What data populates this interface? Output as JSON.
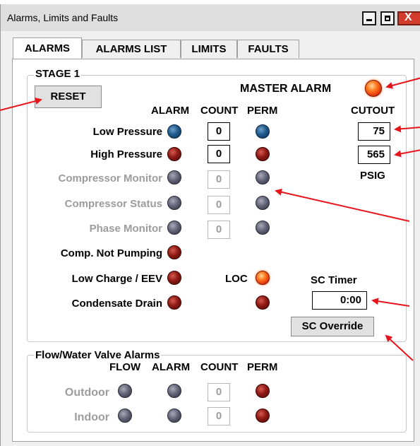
{
  "window": {
    "title": "Alarms, Limits and Faults",
    "controls": {
      "minimize_icon": "minimize-icon",
      "maximize_icon": "maximize-icon",
      "close_glyph": "X"
    }
  },
  "tabs": [
    {
      "label": "ALARMS",
      "active": true
    },
    {
      "label": "ALARMS LIST",
      "active": false
    },
    {
      "label": "LIMITS",
      "active": false
    },
    {
      "label": "FAULTS",
      "active": false
    }
  ],
  "stage": {
    "title": "STAGE 1",
    "reset_label": "RESET",
    "master_alarm": {
      "label": "MASTER ALARM",
      "indicator": "on",
      "color": "#ff5a1a"
    },
    "columns": {
      "alarm": "ALARM",
      "count": "COUNT",
      "perm": "PERM"
    },
    "cutout": {
      "header": "CUTOUT",
      "low_value": "75",
      "high_value": "565",
      "unit": "PSIG"
    },
    "rows": [
      {
        "label": "Low Pressure",
        "enabled": true,
        "alarm_color": "blue",
        "count": "0",
        "perm_color": "blue"
      },
      {
        "label": "High Pressure",
        "enabled": true,
        "alarm_color": "red",
        "count": "0",
        "perm_color": "red"
      },
      {
        "label": "Compressor Monitor",
        "enabled": false,
        "alarm_color": "gray",
        "count": "0",
        "perm_color": "gray"
      },
      {
        "label": "Compressor Status",
        "enabled": false,
        "alarm_color": "gray",
        "count": "0",
        "perm_color": "gray"
      },
      {
        "label": "Phase Monitor",
        "enabled": false,
        "alarm_color": "gray",
        "count": "0",
        "perm_color": "gray"
      },
      {
        "label": "Comp. Not Pumping",
        "enabled": true,
        "alarm_color": "red"
      },
      {
        "label": "Low Charge / EEV",
        "enabled": true,
        "alarm_color": "red"
      },
      {
        "label": "Condensate Drain",
        "enabled": true,
        "alarm_color": "red",
        "perm_color": "red"
      }
    ],
    "loc": {
      "label": "LOC",
      "indicator": "on"
    },
    "sc_timer": {
      "label": "SC Timer",
      "value": "0:00"
    },
    "sc_override_label": "SC Override"
  },
  "flow": {
    "title": "Flow/Water Valve Alarms",
    "columns": {
      "flow": "FLOW",
      "alarm": "ALARM",
      "count": "COUNT",
      "perm": "PERM"
    },
    "rows": [
      {
        "label": "Outdoor",
        "flow_color": "gray",
        "alarm_color": "gray",
        "count": "0",
        "perm_color": "red"
      },
      {
        "label": "Indoor",
        "flow_color": "gray",
        "alarm_color": "gray",
        "count": "0",
        "perm_color": "red"
      }
    ]
  },
  "annotation_color": "#e8141c"
}
